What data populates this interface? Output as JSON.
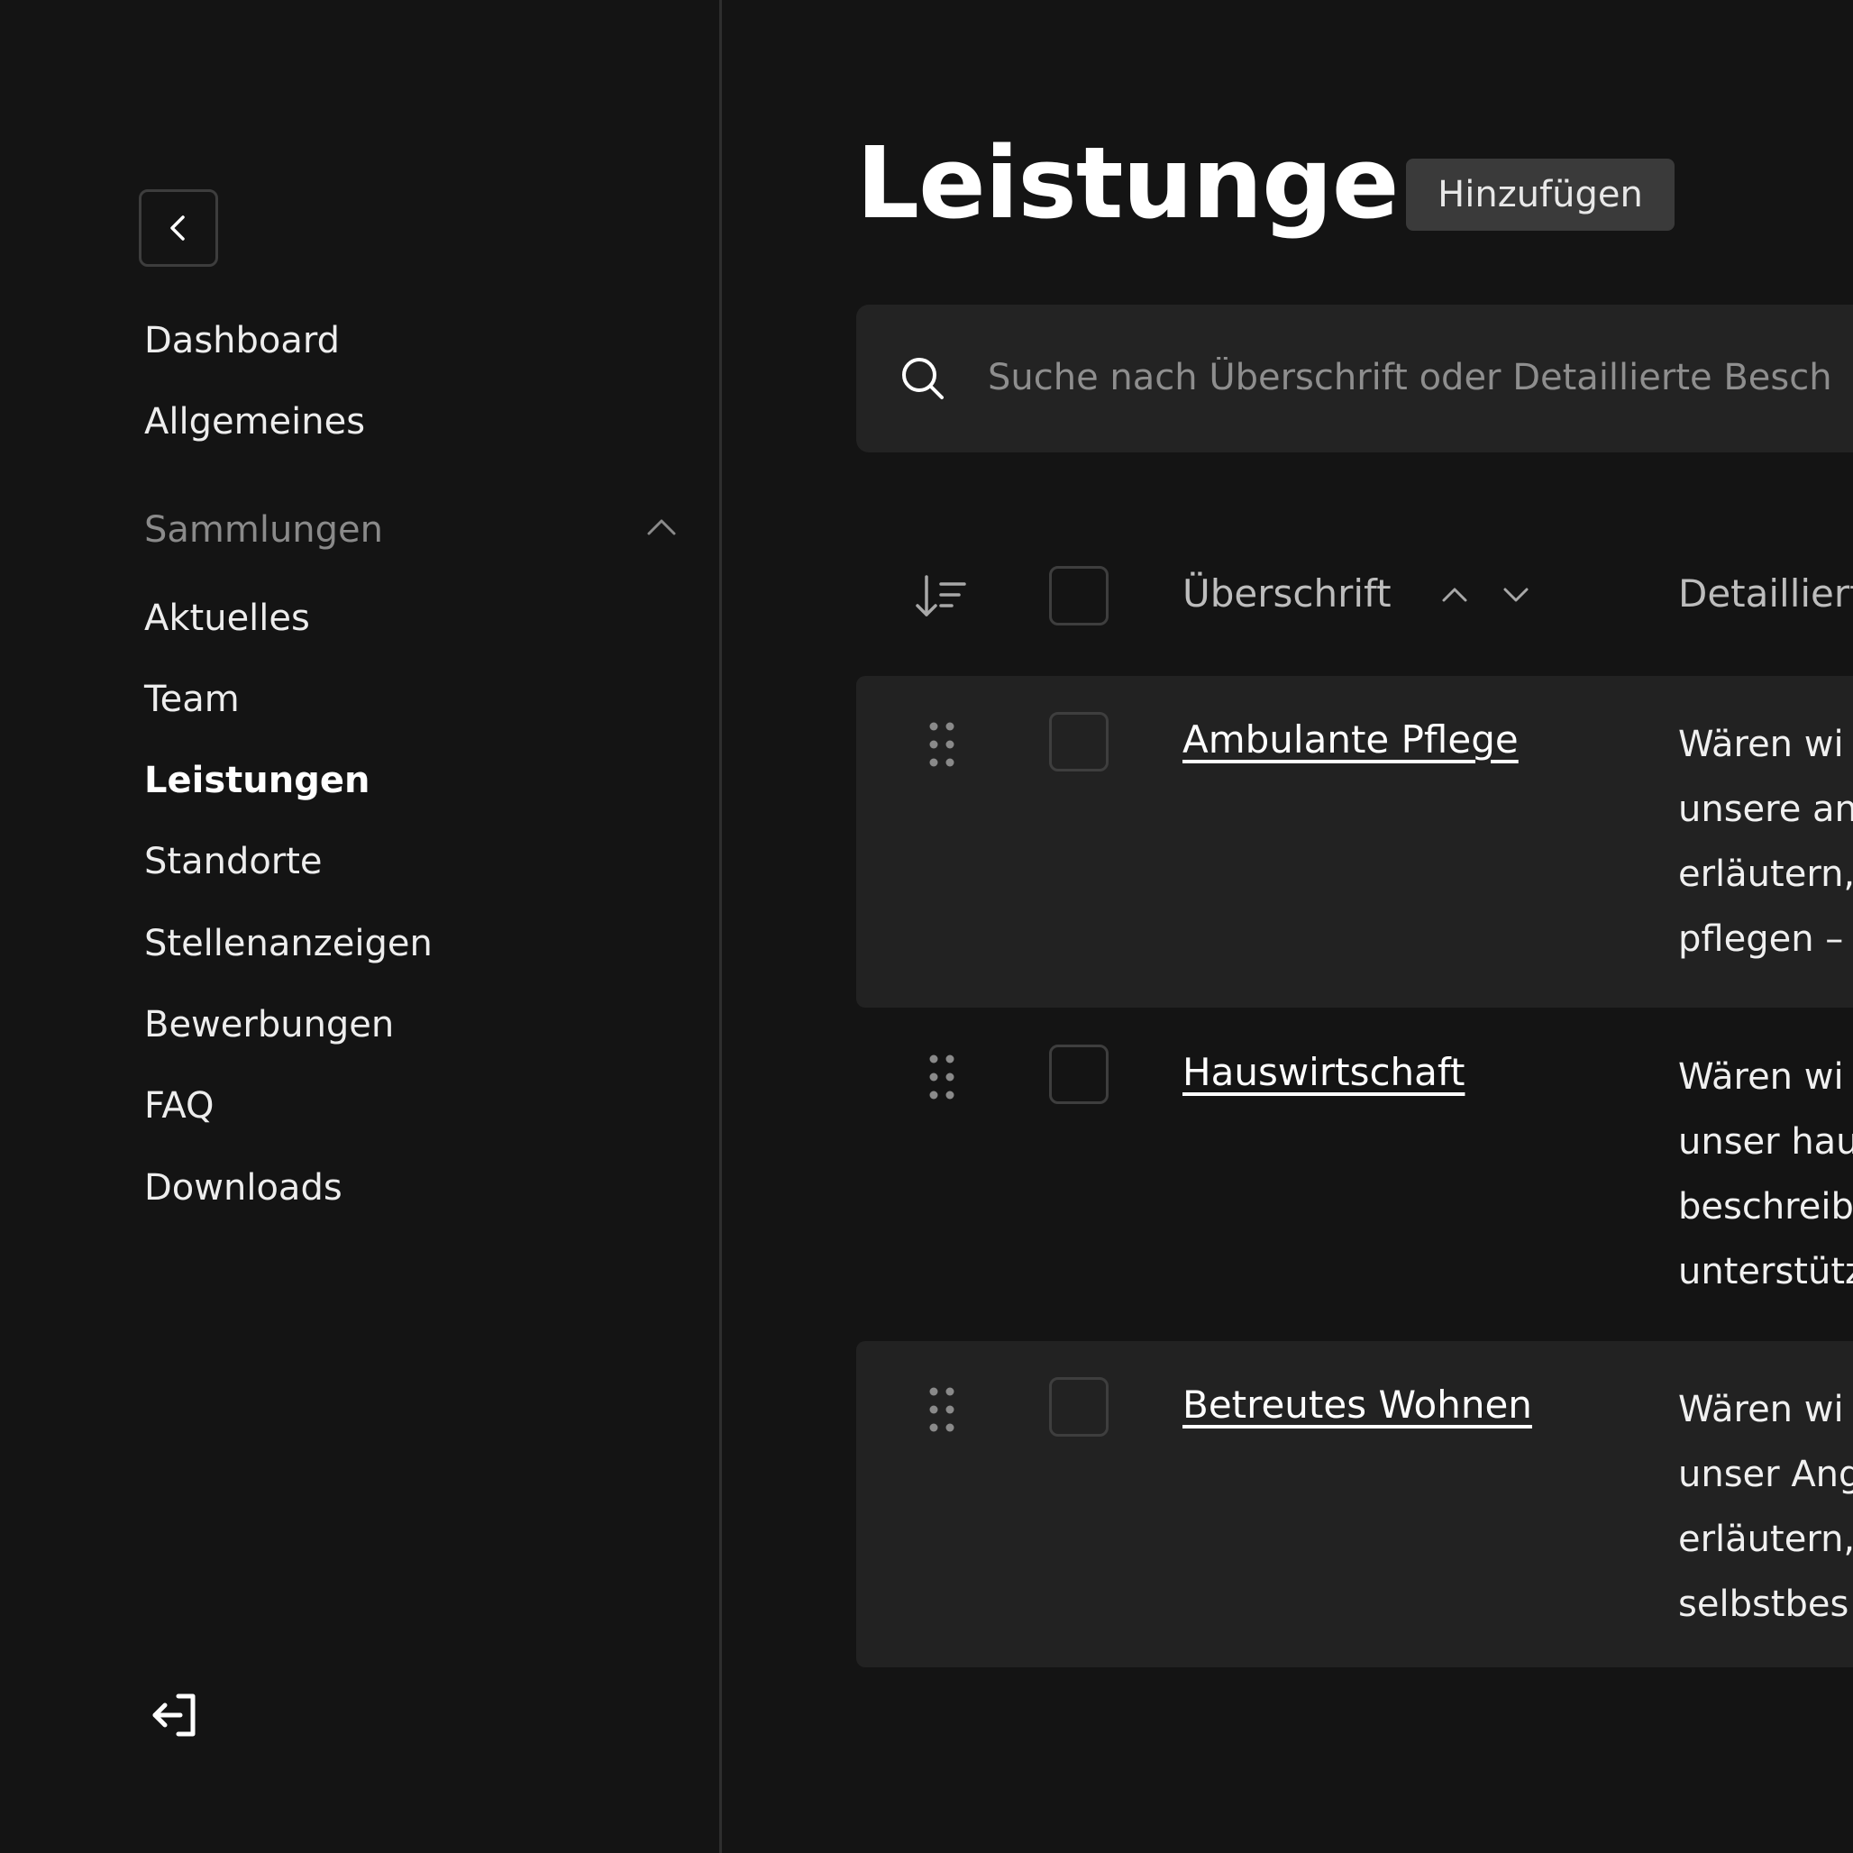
{
  "sidebar": {
    "back_label": "back",
    "nav": {
      "dashboard": "Dashboard",
      "allgemeines": "Allgemeines"
    },
    "section_title": "Sammlungen",
    "items": {
      "aktuelles": "Aktuelles",
      "team": "Team",
      "leistungen": "Leistungen",
      "standorte": "Standorte",
      "stellenanzeigen": "Stellenanzeigen",
      "bewerbungen": "Bewerbungen",
      "faq": "FAQ",
      "downloads": "Downloads"
    },
    "active_item": "Leistungen"
  },
  "main": {
    "title": "Leistungen",
    "add_button": "Hinzufügen",
    "search": {
      "placeholder": "Suche nach Überschrift oder Detaillierte Besch",
      "value": ""
    },
    "table": {
      "columns": {
        "title": "Überschrift",
        "description": "Detailliert"
      },
      "rows": [
        {
          "title": "Ambulante Pflege",
          "desc": [
            "Wären wi",
            "unsere an",
            "erläutern,",
            "pflegen –"
          ]
        },
        {
          "title": "Hauswirtschaft",
          "desc": [
            "Wären wi",
            "unser hau",
            "beschreib",
            "unterstütz"
          ]
        },
        {
          "title": "Betreutes Wohnen",
          "desc": [
            "Wären wi",
            "unser Ang",
            "erläutern,",
            "selbstbes"
          ]
        }
      ]
    }
  },
  "colors": {
    "background": "#141414",
    "row_shade": "#222222",
    "button_bg": "#3a3a3a",
    "muted_text": "#8a8a8a"
  },
  "icons": [
    "chevron-left-icon",
    "chevron-up-icon",
    "logout-icon",
    "search-icon",
    "sort-icon",
    "sort-asc-icon",
    "sort-desc-icon",
    "drag-handle-icon"
  ]
}
